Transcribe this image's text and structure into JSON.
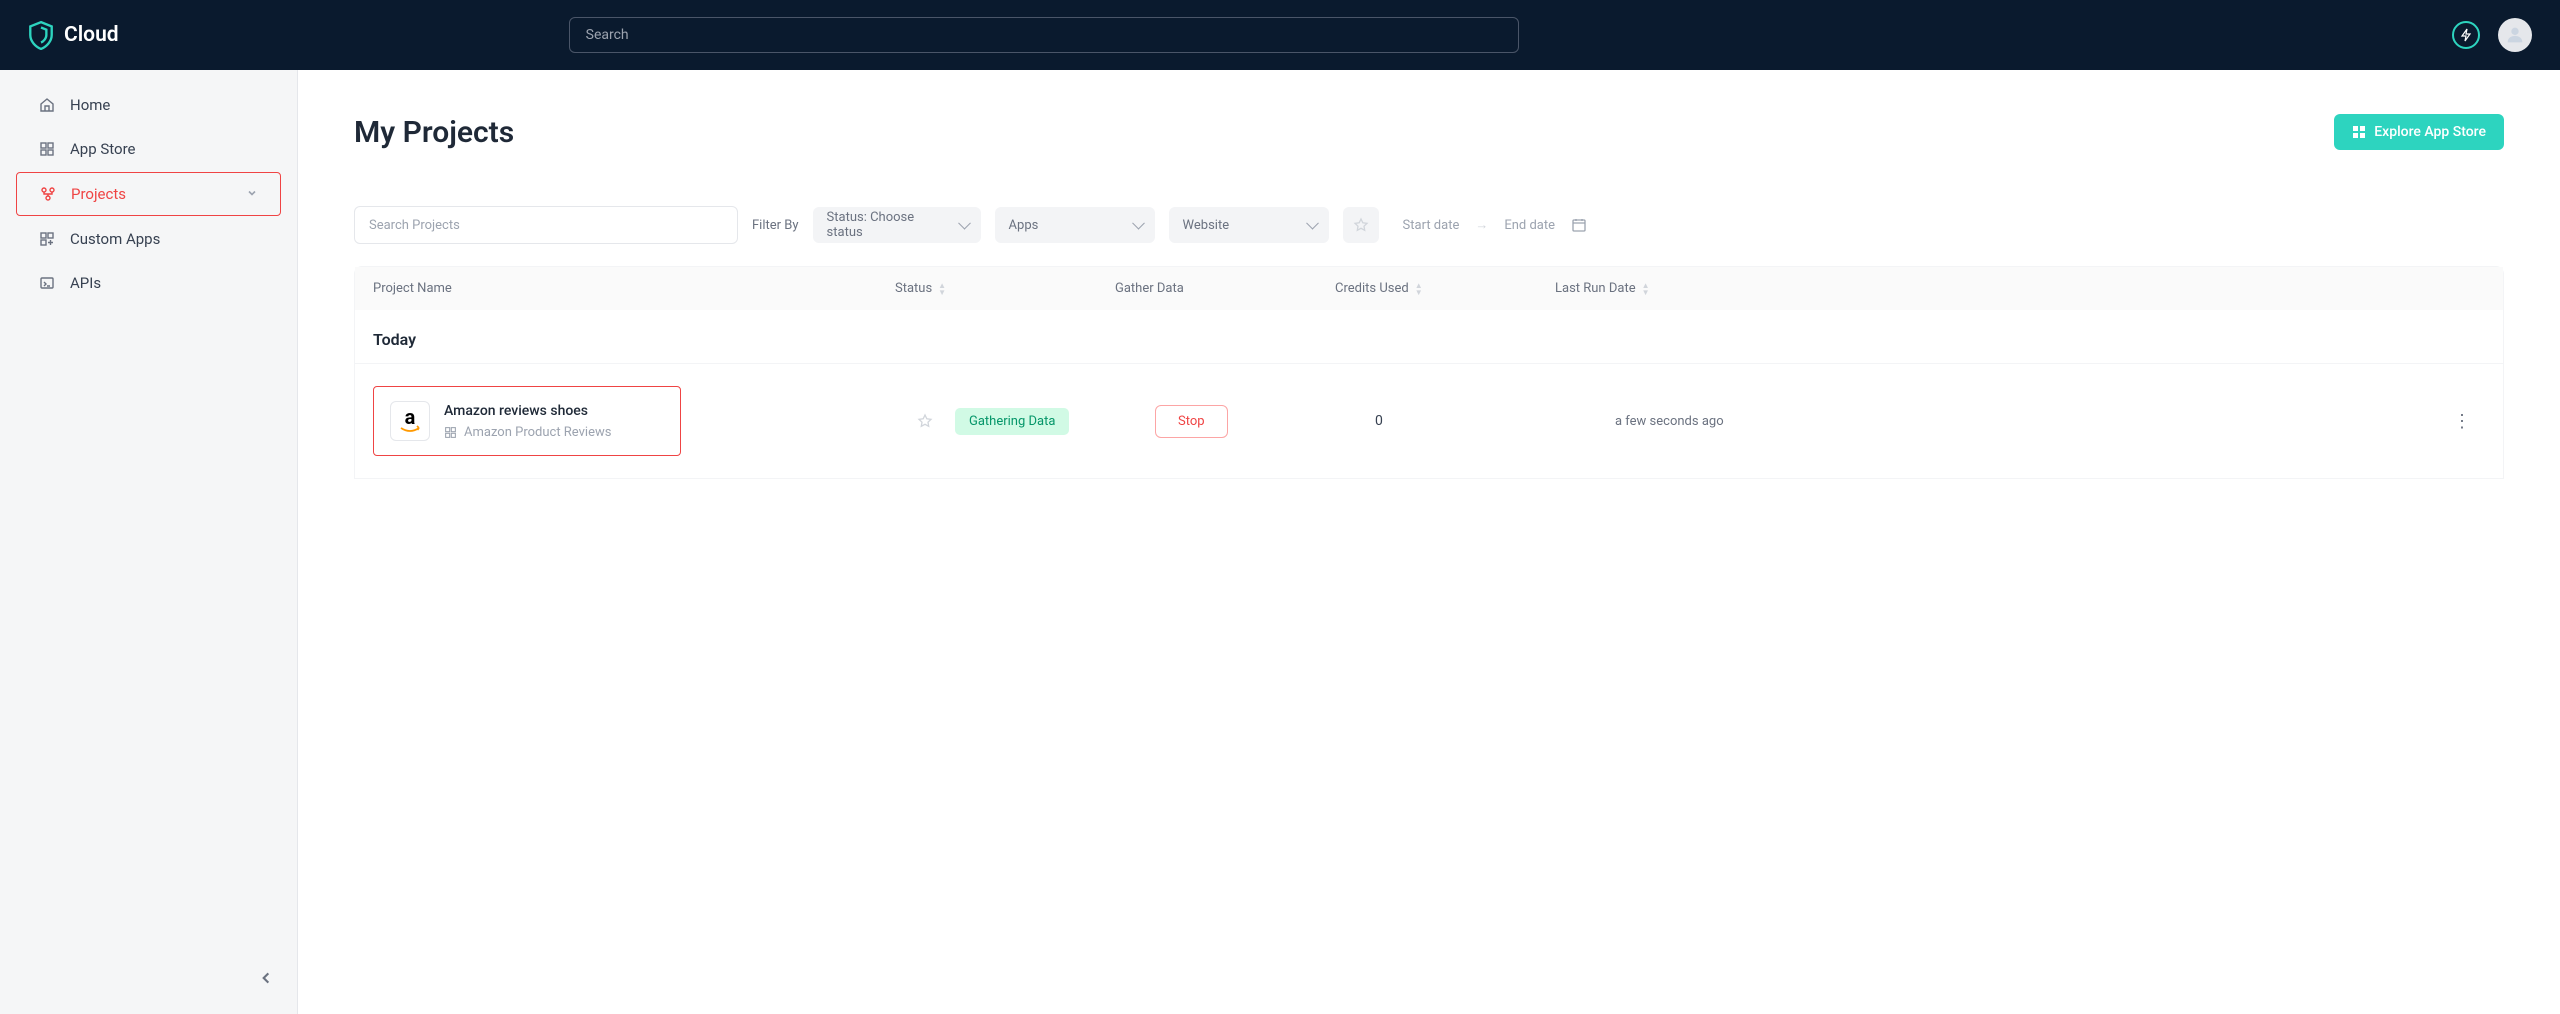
{
  "header": {
    "brand": "Cloud",
    "search_placeholder": "Search"
  },
  "sidebar": {
    "items": [
      {
        "label": "Home"
      },
      {
        "label": "App Store"
      },
      {
        "label": "Projects"
      },
      {
        "label": "Custom Apps"
      },
      {
        "label": "APIs"
      }
    ]
  },
  "page": {
    "title": "My Projects",
    "explore_label": "Explore App Store"
  },
  "filters": {
    "search_placeholder": "Search Projects",
    "filter_by": "Filter By",
    "status_label": "Status: Choose status",
    "apps_label": "Apps",
    "website_label": "Website",
    "start_date": "Start date",
    "end_date": "End date"
  },
  "columns": {
    "name": "Project Name",
    "status": "Status",
    "gather": "Gather Data",
    "credits": "Credits Used",
    "last": "Last Run Date"
  },
  "group_label": "Today",
  "project": {
    "name": "Amazon reviews shoes",
    "subtitle": "Amazon Product Reviews",
    "status": "Gathering Data",
    "action": "Stop",
    "credits": "0",
    "last_run": "a few seconds ago"
  }
}
